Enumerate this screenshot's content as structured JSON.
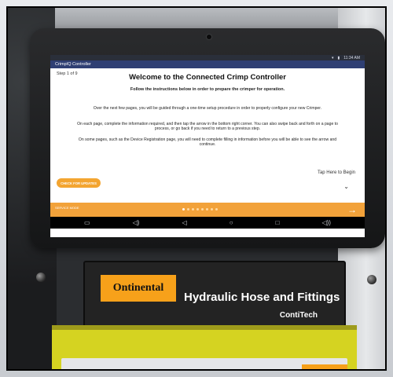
{
  "status": {
    "time": "11:34 AM"
  },
  "app": {
    "name": "CrimpIQ Controller"
  },
  "screen": {
    "step": "Step 1 of 9",
    "title": "Welcome to the Connected Crimp Controller",
    "subtitle": "Follow the instructions below in order to prepare the crimper for operation.",
    "paragraphs": [
      "Over the next few pages, you will be guided through a one-time setup procedure in order to properly configure your new Crimper.",
      "On each page, complete the information required, and then tap the arrow in the bottom right corner. You can also swipe back and forth on a page to process, or go back if you need to return to a previous step.",
      "On some pages, such as the Device Registration page, you will need to complete filling in information before you will be able to see the arrow and continue."
    ],
    "check_updates": "CHECK FOR UPDATES",
    "tap_hint": "Tap Here to Begin",
    "service_mode": "SERVICE MODE"
  },
  "placard": {
    "brand": "Ontinental",
    "title": "Hydraulic Hose and Fittings",
    "sub": "ContiTech"
  },
  "colors": {
    "accent": "#f2a23a",
    "appbar": "#2f3f73",
    "logo": "#f7a11a"
  }
}
